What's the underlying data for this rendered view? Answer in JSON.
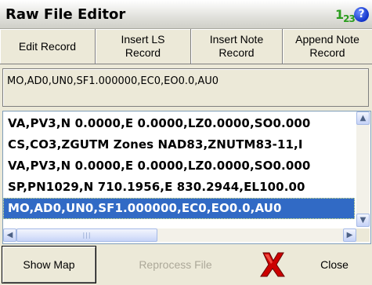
{
  "window": {
    "title": "Raw File Editor",
    "num_icon": "1",
    "num_icon_sub": "23",
    "help_icon": "?"
  },
  "toolbar": {
    "edit_record": "Edit Record",
    "insert_ls_1": "Insert LS",
    "insert_ls_2": "Record",
    "insert_note_1": "Insert Note",
    "insert_note_2": "Record",
    "append_note_1": "Append Note",
    "append_note_2": "Record"
  },
  "current_record": "MO,AD0,UN0,SF1.000000,EC0,EO0.0,AU0",
  "records": [
    "VA,PV3,N 0.0000,E 0.0000,LZ0.0000,SO0.000",
    "CS,CO3,ZGUTM Zones NAD83,ZNUTM83-11,I",
    "VA,PV3,N 0.0000,E 0.0000,LZ0.0000,SO0.000",
    "SP,PN1029,N 710.1956,E 830.2944,EL100.00",
    "MO,AD0,UN0,SF1.000000,EC0,EO0.0,AU0"
  ],
  "selected_index": 4,
  "bottom": {
    "show_map": "Show Map",
    "reprocess": "Reprocess File",
    "close": "Close"
  },
  "colors": {
    "selection": "#316ac5",
    "close_x": "#cc0000",
    "help": "#1133c8",
    "num_icon": "#2a9d1e"
  }
}
